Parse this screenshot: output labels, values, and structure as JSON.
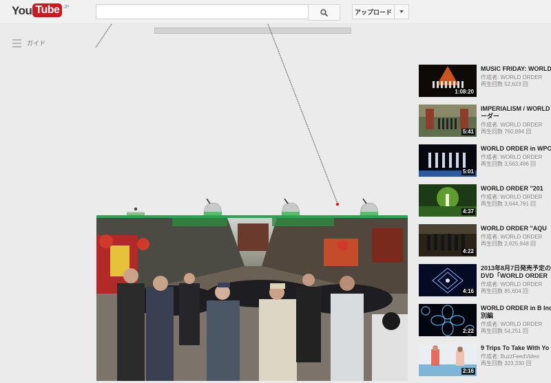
{
  "masthead": {
    "logo_you": "You",
    "logo_tube": "Tube",
    "logo_region": "JP",
    "search_value": "",
    "upload_label": "アップロード"
  },
  "guide": {
    "label": "ガイド"
  },
  "colors": {
    "brand_red": "#cc181e",
    "ground_green": "#27a654",
    "background": "#ebebeb"
  },
  "related": [
    {
      "title": "MUSIC FRIDAY: WORLD",
      "channel": "作成者: WORLD ORDER",
      "views": "再生回数 52,623 回",
      "duration": "1:08:20"
    },
    {
      "title": "IMPERIALISM / WORLD オーダー",
      "channel": "作成者: WORLD ORDER",
      "views": "再生回数 760,894 回",
      "duration": "5:41"
    },
    {
      "title": "WORLD ORDER in WPC",
      "channel": "作成者: WORLD ORDER",
      "views": "再生回数 3,563,496 回",
      "duration": "5:01"
    },
    {
      "title": "WORLD ORDER \"201",
      "channel": "作成者: WORLD ORDER",
      "views": "再生回数 3,644,791 回",
      "duration": "4:37"
    },
    {
      "title": "WORLD ORDER \"AQU",
      "channel": "作成者: WORLD ORDER",
      "views": "再生回数 2,825,848 回",
      "duration": "4:22"
    },
    {
      "title": "2013年8月7日発売予定の DVD「WORLD ORDER",
      "channel": "作成者: WORLD ORDER",
      "views": "再生回数 85,604 回",
      "duration": "4:16"
    },
    {
      "title": "WORLD ORDER in B Inc. 特別編",
      "channel": "作成者: WORLD ORDER",
      "views": "再生回数 54,251 回",
      "duration": "2:22"
    },
    {
      "title": "9 Trips To Take With Yo",
      "channel": "作成者: BuzzFeedVideo",
      "views": "再生回数 323,330 回",
      "duration": "2:16"
    }
  ]
}
